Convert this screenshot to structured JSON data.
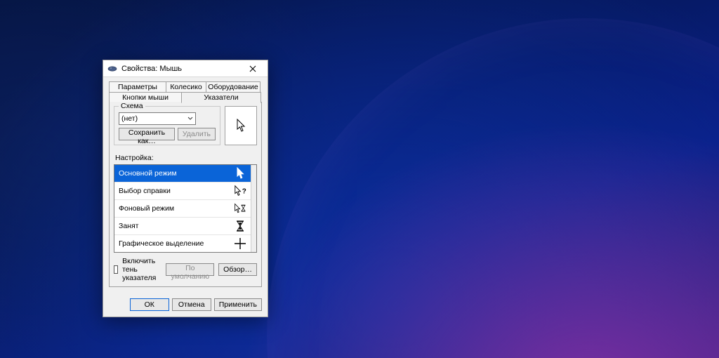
{
  "window": {
    "title": "Свойства: Мышь"
  },
  "tabs": {
    "row1": [
      "Параметры указателя",
      "Колесико",
      "Оборудование"
    ],
    "row2": [
      "Кнопки мыши",
      "Указатели"
    ],
    "active": "Указатели"
  },
  "scheme": {
    "group_label": "Схема",
    "combo_value": "(нет)",
    "save_as": "Сохранить как…",
    "delete": "Удалить"
  },
  "customize_label": "Настройка:",
  "pointers": [
    {
      "name": "Основной режим",
      "icon": "arrow",
      "selected": true
    },
    {
      "name": "Выбор справки",
      "icon": "arrow-help",
      "selected": false
    },
    {
      "name": "Фоновый режим",
      "icon": "arrow-hourglass",
      "selected": false
    },
    {
      "name": "Занят",
      "icon": "hourglass",
      "selected": false
    },
    {
      "name": "Графическое выделение",
      "icon": "crosshair",
      "selected": false
    }
  ],
  "shadow_checkbox": "Включить тень указателя",
  "defaults_btn": "По умолчанию",
  "browse_btn": "Обзор…",
  "dialog": {
    "ok": "ОК",
    "cancel": "Отмена",
    "apply": "Применить"
  }
}
